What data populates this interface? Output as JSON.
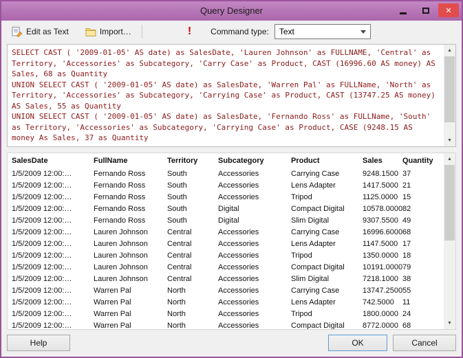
{
  "window": {
    "title": "Query Designer"
  },
  "colors": {
    "titlebar_top": "#c487c4",
    "titlebar_bottom": "#aa66aa",
    "window_border": "#9b549b",
    "close_button": "#e14c4c",
    "sql_text": "#8b1a1a"
  },
  "toolbar": {
    "edit_as_text_label": "Edit as Text",
    "import_label": "Import…",
    "command_type_label": "Command type:",
    "command_type_value": "Text"
  },
  "sql": {
    "text": "SELECT CAST ( '2009-01-05' AS date) as SalesDate, 'Lauren Johnson' as FULLNAME, 'Central' as Territory, 'Accessories' as Subcategory, 'Carry Case' as Product, CAST (16996.60 AS money) AS Sales, 68 as Quantity\nUNION SELECT CAST ( '2009-01-05' AS date) as SalesDate, 'Warren Pal' as FULLName, 'North' as Territory, 'Accessories' as Subcategory, 'Carrying Case' as Product, CAST (13747.25 AS money) AS Sales, 55 as Quantity\nUNION SELECT CAST ( '2009-01-05' AS date) as SalesDate, 'Fernando Ross' as FULLName, 'South' as Territory, 'Accessories' as Subcategory, 'Carrying Case' as Product, CASE (9248.15 AS money As Sales, 37 as Quantity"
  },
  "grid": {
    "columns": [
      "SalesDate",
      "FullName",
      "Territory",
      "Subcategory",
      "Product",
      "Sales",
      "Quantity"
    ],
    "rows": [
      [
        "1/5/2009 12:00:…",
        "Fernando Ross",
        "South",
        "Accessories",
        "Carrying Case",
        "9248.1500",
        "37"
      ],
      [
        "1/5/2009 12:00:…",
        "Fernando Ross",
        "South",
        "Accessories",
        "Lens Adapter",
        "1417.5000",
        "21"
      ],
      [
        "1/5/2009 12:00:…",
        "Fernando Ross",
        "South",
        "Accessories",
        "Tripod",
        "1125.0000",
        "15"
      ],
      [
        "1/5/2009 12:00:…",
        "Fernando Ross",
        "South",
        "Digital",
        "Compact Digital",
        "10578.0000",
        "82"
      ],
      [
        "1/5/2009 12:00:…",
        "Fernando Ross",
        "South",
        "Digital",
        "Slim Digital",
        "9307.5500",
        "49"
      ],
      [
        "1/5/2009 12:00:…",
        "Lauren Johnson",
        "Central",
        "Accessories",
        "Carrying Case",
        "16996.6000",
        "68"
      ],
      [
        "1/5/2009 12:00:…",
        "Lauren Johnson",
        "Central",
        "Accessories",
        "Lens Adapter",
        "1147.5000",
        "17"
      ],
      [
        "1/5/2009 12:00:…",
        "Lauren Johnson",
        "Central",
        "Accessories",
        "Tripod",
        "1350.0000",
        "18"
      ],
      [
        "1/5/2009 12:00:…",
        "Lauren Johnson",
        "Central",
        "Accessories",
        "Compact Digital",
        "10191.0000",
        "79"
      ],
      [
        "1/5/2009 12:00:…",
        "Lauren Johnson",
        "Central",
        "Accessories",
        "Slim Digital",
        "7218.1000",
        "38"
      ],
      [
        "1/5/2009 12:00:…",
        "Warren Pal",
        "North",
        "Accessories",
        "Carrying Case",
        "13747.2500",
        "55"
      ],
      [
        "1/5/2009 12:00:…",
        "Warren Pal",
        "North",
        "Accessories",
        "Lens Adapter",
        "742.5000",
        "11"
      ],
      [
        "1/5/2009 12:00:…",
        "Warren Pal",
        "North",
        "Accessories",
        "Tripod",
        "1800.0000",
        "24"
      ],
      [
        "1/5/2009 12:00:…",
        "Warren Pal",
        "North",
        "Accessories",
        "Compact Digital",
        "8772.0000",
        "68"
      ]
    ]
  },
  "footer": {
    "help_label": "Help",
    "ok_label": "OK",
    "cancel_label": "Cancel"
  }
}
